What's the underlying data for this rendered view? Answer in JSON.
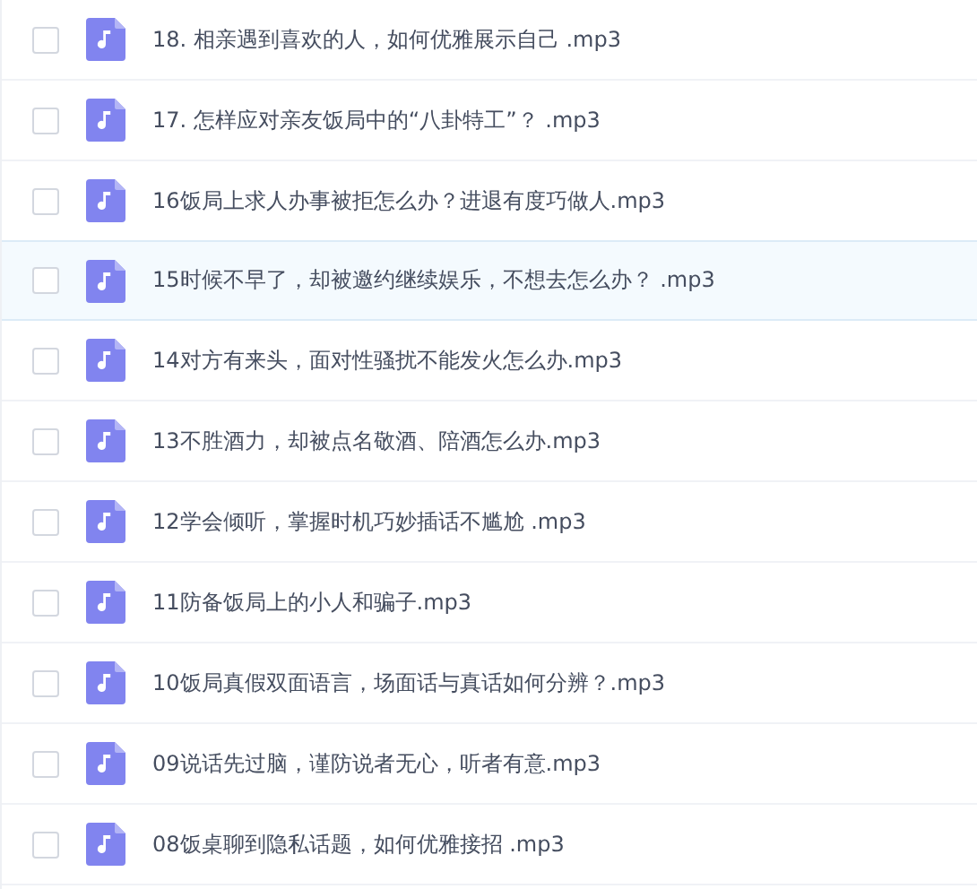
{
  "files": [
    {
      "name": "18. 相亲遇到喜欢的人，如何优雅展示自己 .mp3",
      "checked": false,
      "selected": false
    },
    {
      "name": "17. 怎样应对亲友饭局中的“八卦特工”？ .mp3",
      "checked": false,
      "selected": false
    },
    {
      "name": "16饭局上求人办事被拒怎么办？进退有度巧做人.mp3",
      "checked": false,
      "selected": false
    },
    {
      "name": "15时候不早了，却被邀约继续娱乐，不想去怎么办？ .mp3",
      "checked": false,
      "selected": true
    },
    {
      "name": "14对方有来头，面对性骚扰不能发火怎么办.mp3",
      "checked": false,
      "selected": false
    },
    {
      "name": "13不胜酒力，却被点名敬酒、陪酒怎么办.mp3",
      "checked": false,
      "selected": false
    },
    {
      "name": "12学会倾听，掌握时机巧妙插话不尴尬 .mp3",
      "checked": false,
      "selected": false
    },
    {
      "name": "11防备饭局上的小人和骗子.mp3",
      "checked": false,
      "selected": false
    },
    {
      "name": "10饭局真假双面语言，场面话与真话如何分辨？.mp3",
      "checked": false,
      "selected": false
    },
    {
      "name": "09说话先过脑，谨防说者无心，听者有意.mp3",
      "checked": false,
      "selected": false
    },
    {
      "name": "08饭桌聊到隐私话题，如何优雅接招 .mp3",
      "checked": false,
      "selected": false
    }
  ]
}
